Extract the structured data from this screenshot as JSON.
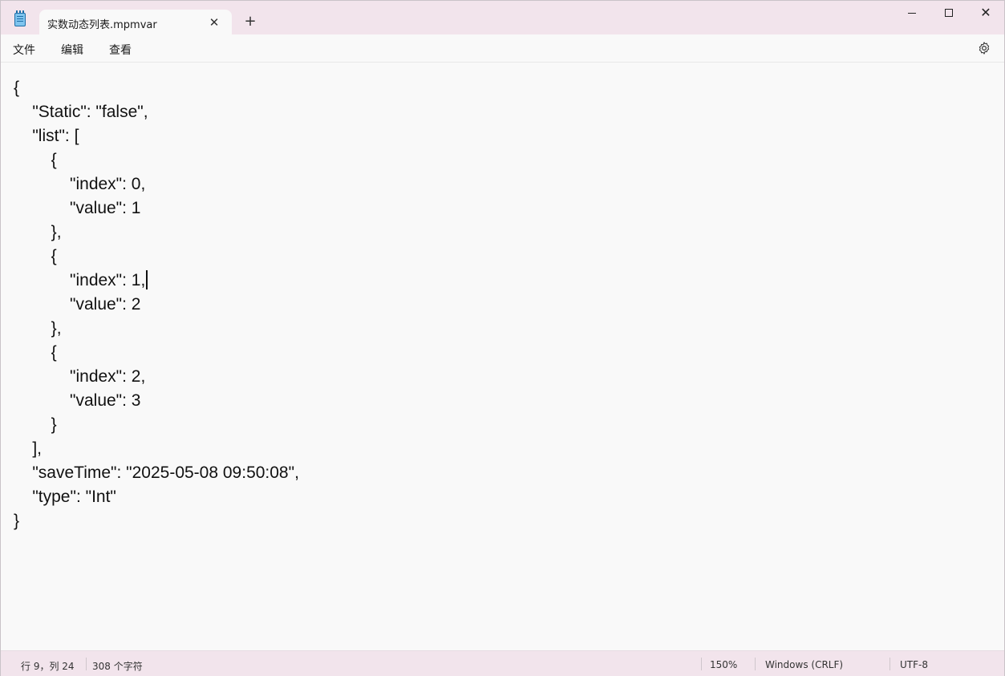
{
  "window": {
    "tab_title": "实数动态列表.mpmvar",
    "tab_close_glyph": "✕",
    "new_tab_glyph": "+",
    "close_glyph": "✕"
  },
  "menu": {
    "file": "文件",
    "edit": "编辑",
    "view": "查看"
  },
  "editor": {
    "lines": [
      "{",
      "    \"Static\": \"false\",",
      "    \"list\": [",
      "        {",
      "            \"index\": 0,",
      "            \"value\": 1",
      "        },",
      "        {",
      "            \"index\": 1,",
      "            \"value\": 2",
      "        },",
      "        {",
      "            \"index\": 2,",
      "            \"value\": 3",
      "        }",
      "    ],",
      "    \"saveTime\": \"2025-05-08 09:50:08\",",
      "    \"type\": \"Int\"",
      "}"
    ],
    "caret_line": 9
  },
  "status": {
    "position": "行 9，列 24",
    "char_count": "308 个字符",
    "zoom": "150%",
    "line_ending": "Windows (CRLF)",
    "encoding": "UTF-8"
  },
  "icons": {
    "app": "notepad-icon",
    "settings": "gear-icon"
  }
}
